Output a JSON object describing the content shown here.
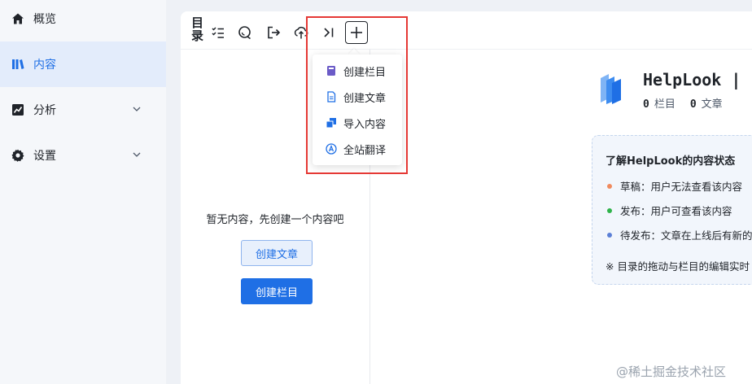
{
  "sidebar": {
    "items": [
      {
        "label": "概览",
        "icon": "home-icon"
      },
      {
        "label": "内容",
        "icon": "content-icon",
        "active": true
      },
      {
        "label": "分析",
        "icon": "chart-icon",
        "expandable": true
      },
      {
        "label": "设置",
        "icon": "gear-icon",
        "expandable": true
      }
    ]
  },
  "toolbar": {
    "title": "目录",
    "tools": [
      "checklist-icon",
      "search-icon",
      "export-icon",
      "upload-icon",
      "collapse-icon",
      "plus-icon"
    ]
  },
  "dropdown": {
    "items": [
      {
        "label": "创建栏目",
        "icon": "book-icon"
      },
      {
        "label": "创建文章",
        "icon": "document-icon"
      },
      {
        "label": "导入内容",
        "icon": "import-icon"
      },
      {
        "label": "全站翻译",
        "icon": "translate-icon"
      }
    ]
  },
  "empty_state": {
    "message": "暂无内容，先创建一个内容吧",
    "create_article": "创建文章",
    "create_column": "创建栏目"
  },
  "header": {
    "brand": "HelpLook |",
    "column_count": "0",
    "column_label": "栏目",
    "article_count": "0",
    "article_label": "文章"
  },
  "info": {
    "title": "了解HelpLook的内容状态",
    "rows": [
      {
        "text": "草稿：用户无法查看该内容",
        "color": "#f08a5d"
      },
      {
        "text": "发布：用户可查看该内容",
        "color": "#2fb34a"
      },
      {
        "text": "待发布：文章在上线后有新的",
        "color": "#5b7fd6"
      }
    ],
    "note": "※ 目录的拖动与栏目的编辑实时"
  },
  "watermark": "@稀土掘金技术社区",
  "colors": {
    "accent": "#1f6fe5",
    "highlight": "#e53935"
  }
}
